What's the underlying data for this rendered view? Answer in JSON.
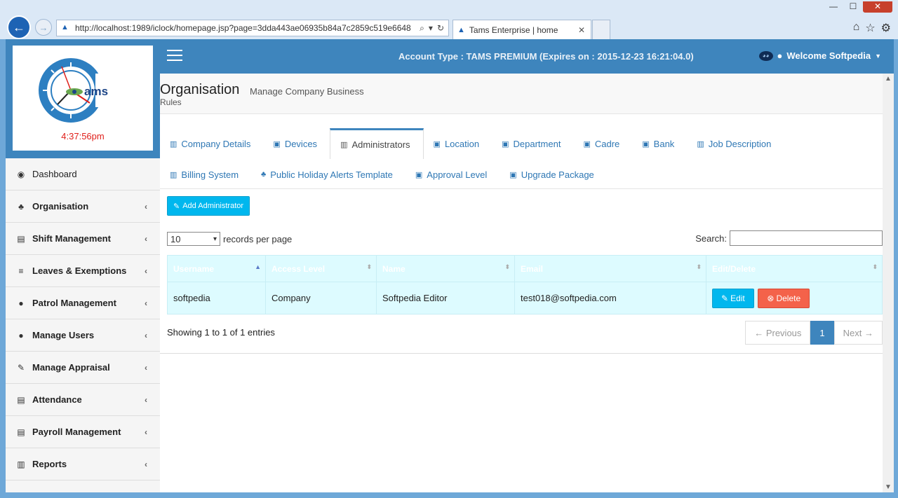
{
  "browser": {
    "url": "http://localhost:1989/iclock/homepage.jsp?page=3dda443ae06935b84a7c2859c519e6648",
    "tab_title": "Tams Enterprise | home",
    "back_icon": "back-arrow-icon",
    "forward_icon": "forward-arrow-icon"
  },
  "logo": {
    "brand": "ams",
    "clock_time": "4:37:56pm"
  },
  "header": {
    "account_type": "Account Type : TAMS PREMIUM (Expires on : 2015-12-23 16:21:04.0)",
    "welcome": "Welcome Softpedia"
  },
  "sidebar": {
    "items": [
      {
        "label": "Dashboard",
        "icon": "dashboard-icon"
      },
      {
        "label": "Organisation",
        "icon": "sitemap-icon"
      },
      {
        "label": "Shift Management",
        "icon": "list-icon"
      },
      {
        "label": "Leaves & Exemptions",
        "icon": "bars-icon"
      },
      {
        "label": "Patrol Management",
        "icon": "user-icon"
      },
      {
        "label": "Manage Users",
        "icon": "user-icon"
      },
      {
        "label": "Manage Appraisal",
        "icon": "edit-icon"
      },
      {
        "label": "Attendance",
        "icon": "list-icon"
      },
      {
        "label": "Payroll Management",
        "icon": "list-icon"
      },
      {
        "label": "Reports",
        "icon": "chart-icon"
      }
    ]
  },
  "page": {
    "title": "Organisation",
    "subtitle": "Manage Company Business",
    "subtitle2": "Rules"
  },
  "tabs": {
    "row1": [
      "Company Details",
      "Devices",
      "Administrators",
      "Location",
      "Department",
      "Cadre",
      "Bank",
      "Job Description"
    ],
    "row2": [
      "Billing System",
      "Public Holiday Alerts Template",
      "Approval Level",
      "Upgrade Package"
    ],
    "active": "Administrators"
  },
  "toolbar": {
    "add_label": "Add Administrator",
    "page_len": "10",
    "records_label": "records per page",
    "search_label": "Search:"
  },
  "table": {
    "columns": [
      "Username",
      "Access Level",
      "Name",
      "Email",
      "Edit/Delete"
    ],
    "rows": [
      {
        "username": "softpedia",
        "access": "Company",
        "name": "Softpedia Editor",
        "email": "test018@softpedia.com"
      }
    ],
    "edit_label": "Edit",
    "delete_label": "Delete"
  },
  "footer": {
    "info": "Showing 1 to 1 of 1 entries",
    "prev": "← Previous",
    "page": "1",
    "next": "Next →"
  },
  "colors": {
    "primary": "#3e85bd",
    "accent": "#00b7ee",
    "danger": "#f4624a",
    "row_bg": "#ddfbff"
  }
}
